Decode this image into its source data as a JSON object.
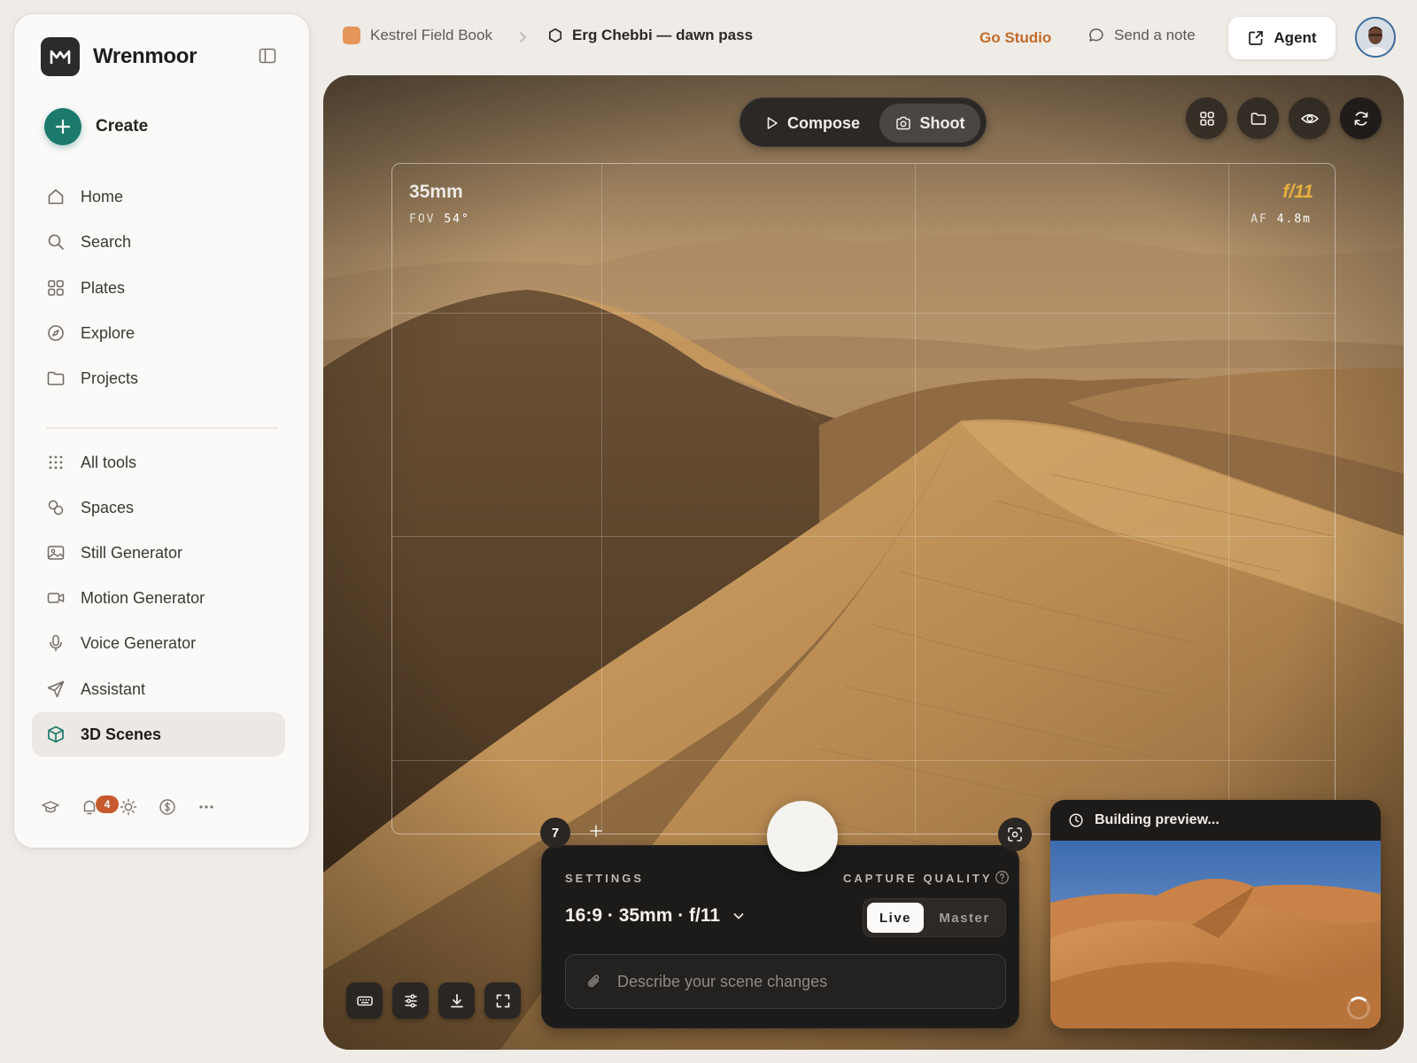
{
  "app": {
    "name": "Wrenmoor"
  },
  "sidebar": {
    "create_label": "Create",
    "primary": [
      {
        "label": "Home",
        "icon": "home-icon"
      },
      {
        "label": "Search",
        "icon": "search-icon"
      },
      {
        "label": "Plates",
        "icon": "grid-icon"
      },
      {
        "label": "Explore",
        "icon": "compass-icon"
      },
      {
        "label": "Projects",
        "icon": "folder-icon"
      }
    ],
    "tools": [
      {
        "label": "All tools",
        "icon": "dots-grid-icon"
      },
      {
        "label": "Spaces",
        "icon": "spaces-icon"
      },
      {
        "label": "Still Generator",
        "icon": "image-icon"
      },
      {
        "label": "Motion Generator",
        "icon": "video-icon"
      },
      {
        "label": "Voice Generator",
        "icon": "microphone-icon"
      },
      {
        "label": "Assistant",
        "icon": "send-icon"
      },
      {
        "label": "3D Scenes",
        "icon": "cube-icon",
        "active": true
      }
    ],
    "notification_count": "4"
  },
  "topbar": {
    "project": "Kestrel Field Book",
    "scene": "Erg Chebbi — dawn pass",
    "go_studio": "Go Studio",
    "send_note": "Send a note",
    "agent": "Agent"
  },
  "viewport": {
    "modes": [
      "Compose",
      "Shoot"
    ],
    "active_mode": "Shoot",
    "focal_length": "35mm",
    "fov_label": "FOV",
    "fov_value": "54°",
    "aperture": "f/11",
    "af_label": "AF",
    "af_value": "4.8m",
    "shot_count": "7"
  },
  "settings_panel": {
    "settings_label": "SETTINGS",
    "capture_quality_label": "CAPTURE QUALITY",
    "preset": "16:9 · 35mm · f/11",
    "quality_options": [
      "Live",
      "Master"
    ],
    "quality_selected": "Live",
    "prompt_placeholder": "Describe your scene changes"
  },
  "preview": {
    "status": "Building preview..."
  },
  "colors": {
    "accent": "#1c7a6c",
    "brand_orange": "#c26b2c",
    "aperture": "#e8b040",
    "badge": "#c65a2e"
  }
}
